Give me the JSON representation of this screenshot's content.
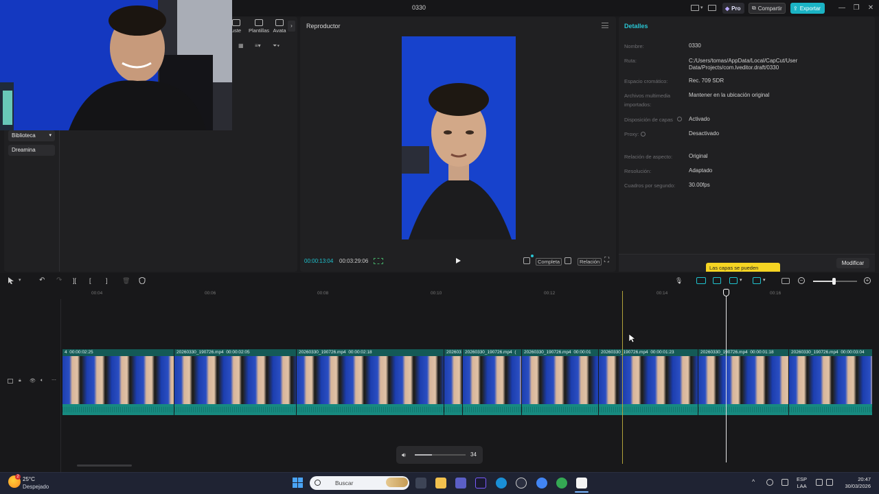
{
  "window": {
    "title": "0330",
    "pro_label": "Pro",
    "share_label": "Compartir",
    "export_label": "Exportar"
  },
  "media_panel": {
    "tabs": [
      {
        "label": "uste",
        "icon": "adjust-icon"
      },
      {
        "label": "Plantillas",
        "icon": "templates-icon"
      },
      {
        "label": "Avata",
        "icon": "avatar-icon"
      }
    ],
    "sidebar": [
      {
        "label": "Biblioteca",
        "has_dropdown": true
      },
      {
        "label": "Dreamina",
        "has_dropdown": false
      }
    ]
  },
  "player": {
    "title": "Reproductor",
    "current_time": "00:00:13:04",
    "total_time": "00:03:29:06",
    "full_label": "Completa",
    "ratio_label": "Relación"
  },
  "details": {
    "title": "Detalles",
    "rows": [
      {
        "label": "Nombre:",
        "value": "0330"
      },
      {
        "label": "Ruta:",
        "value": "C:/Users/tomas/AppData/Local/CapCut/User Data/Projects/com.lveditor.draft/0330"
      },
      {
        "label": "Espacio cromático:",
        "value": "Rec. 709 SDR"
      },
      {
        "label": "Archivos multimedia importados:",
        "value": "Mantener en la ubicación original"
      },
      {
        "label": "Disposición de capas",
        "value": "Activado"
      },
      {
        "label": "Proxy:",
        "value": "Desactivado"
      },
      {
        "label": "Relación de aspecto:",
        "value": "Original"
      },
      {
        "label": "Resolución:",
        "value": "Adaptado"
      },
      {
        "label": "Cuadros por segundo:",
        "value": "30.00fps"
      }
    ],
    "modify_label": "Modificar",
    "tooltip": "Las capas se pueden"
  },
  "timeline": {
    "ruler": [
      "00:04",
      "00:06",
      "00:08",
      "00:10",
      "00:12",
      "00:14",
      "00:16"
    ],
    "clips": [
      {
        "name": "4",
        "duration": "00:00:02:25"
      },
      {
        "name": "20260330_190726.mp4",
        "duration": "00:00:02:05"
      },
      {
        "name": "20260330_190726.mp4",
        "duration": "00:00:02:18"
      },
      {
        "name": "202603",
        "duration": ""
      },
      {
        "name": "20260330_190726.mp4",
        "duration": "("
      },
      {
        "name": "20260330_190726.mp4",
        "duration": "00:00:01"
      },
      {
        "name": "20260330_190726.mp4",
        "duration": "00:00:01:23"
      },
      {
        "name": "20260330_190726.mp4",
        "duration": "00:00:01:18"
      },
      {
        "name": "20260330_190726.mp4",
        "duration": "00:00:03:04"
      }
    ],
    "volume_value": "34",
    "volume_fraction": 0.34
  },
  "taskbar": {
    "weather_temp": "25°C",
    "weather_desc": "Despejado",
    "weather_badge": "2",
    "search_placeholder": "Buscar",
    "lang_line1": "ESP",
    "lang_line2": "LAA",
    "time": "20:47",
    "date": "30/03/2026"
  },
  "colors": {
    "accent": "#1bb3c4",
    "timeline_clip": "#0f4c48",
    "tooltip": "#f5d423"
  }
}
